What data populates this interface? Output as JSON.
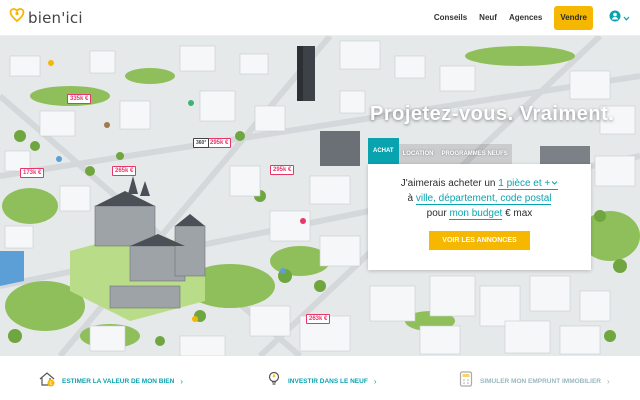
{
  "header": {
    "logo_text": "bien'ici",
    "nav": {
      "conseils": "Conseils",
      "neuf": "Neuf",
      "agences": "Agences",
      "vendre": "Vendre"
    }
  },
  "hero": {
    "slogan": "Projetez-vous. Vraiment.",
    "tabs": {
      "achat": "ACHAT",
      "location": "LOCATION",
      "programmes_neufs": "PROGRAMMES NEUFS"
    },
    "search": {
      "line1_prefix": "J'aimerais acheter un",
      "rooms_value": "1 pièce et +",
      "line2_prefix": "à",
      "location_placeholder": "ville, département, code postal",
      "line3_prefix": "pour",
      "budget_value": "mon budget",
      "line3_suffix": "€ max",
      "cta": "VOIR LES ANNONCES"
    },
    "price_tags": {
      "p1": "335k €",
      "p2": "295k €",
      "p3": "360° 295k €",
      "p4": "173k €",
      "p5": "265k €",
      "p6": "295k €",
      "p7": "263k €",
      "p8": "295k €",
      "p9": "360°"
    }
  },
  "bottom": {
    "estimate": "ESTIMER LA VALEUR DE MON BIEN",
    "invest": "INVESTIR DANS LE NEUF",
    "loan": "SIMULER MON EMPRUNT IMMOBILIER"
  },
  "colors": {
    "brand_yellow": "#f5b700",
    "brand_teal": "#09a3b0",
    "price_pink": "#e8366b"
  }
}
